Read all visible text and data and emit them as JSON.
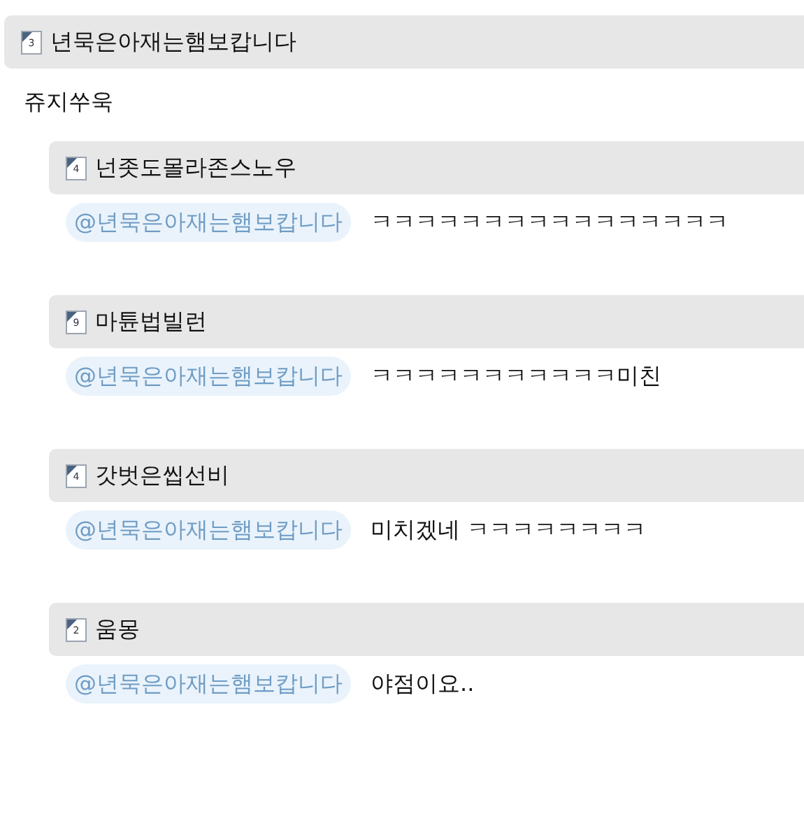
{
  "post": {
    "level": "3",
    "author": "년묵은아재는햄보캅니다",
    "body": "쥬지쑤욱"
  },
  "replies": [
    {
      "level": "4",
      "author": "넌좃도몰라존스노우",
      "mention": "@년묵은아재는햄보캅니다",
      "text": "ㅋㅋㅋㅋㅋㅋㅋㅋㅋㅋㅋㅋㅋㅋㅋㅋ"
    },
    {
      "level": "9",
      "author": "마튠법빌런",
      "mention": "@년묵은아재는햄보캅니다",
      "text": "ㅋㅋㅋㅋㅋㅋㅋㅋㅋㅋㅋ미친"
    },
    {
      "level": "4",
      "author": "갓벗은씹선비",
      "mention": "@년묵은아재는햄보캅니다",
      "text": "미치겠네 ㅋㅋㅋㅋㅋㅋㅋㅋ"
    },
    {
      "level": "2",
      "author": "움몽",
      "mention": "@년묵은아재는햄보캅니다",
      "text": "야점이요.."
    }
  ]
}
